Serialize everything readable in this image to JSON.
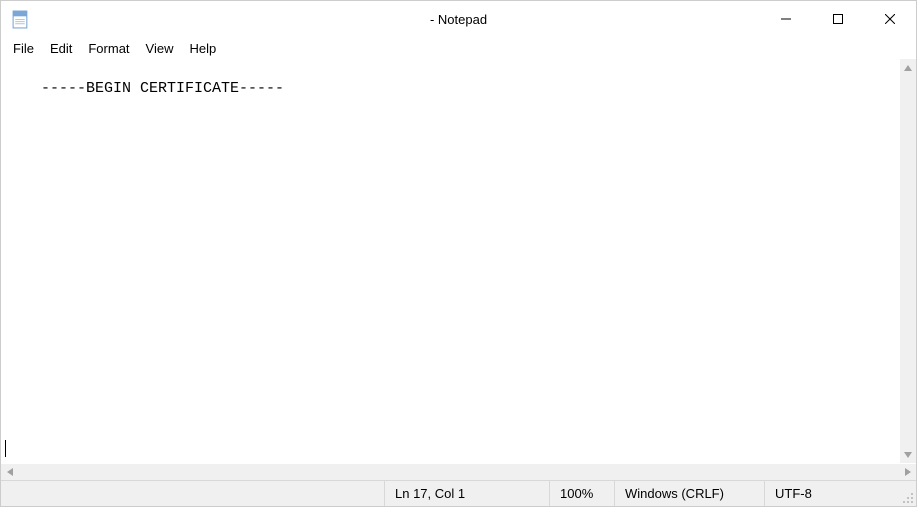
{
  "titlebar": {
    "title": " - Notepad"
  },
  "menu": {
    "file": "File",
    "edit": "Edit",
    "format": "Format",
    "view": "View",
    "help": "Help"
  },
  "editor": {
    "content": "-----BEGIN CERTIFICATE-----"
  },
  "status": {
    "position": "Ln 17, Col 1",
    "zoom": "100%",
    "line_ending": "Windows (CRLF)",
    "encoding": "UTF-8"
  }
}
